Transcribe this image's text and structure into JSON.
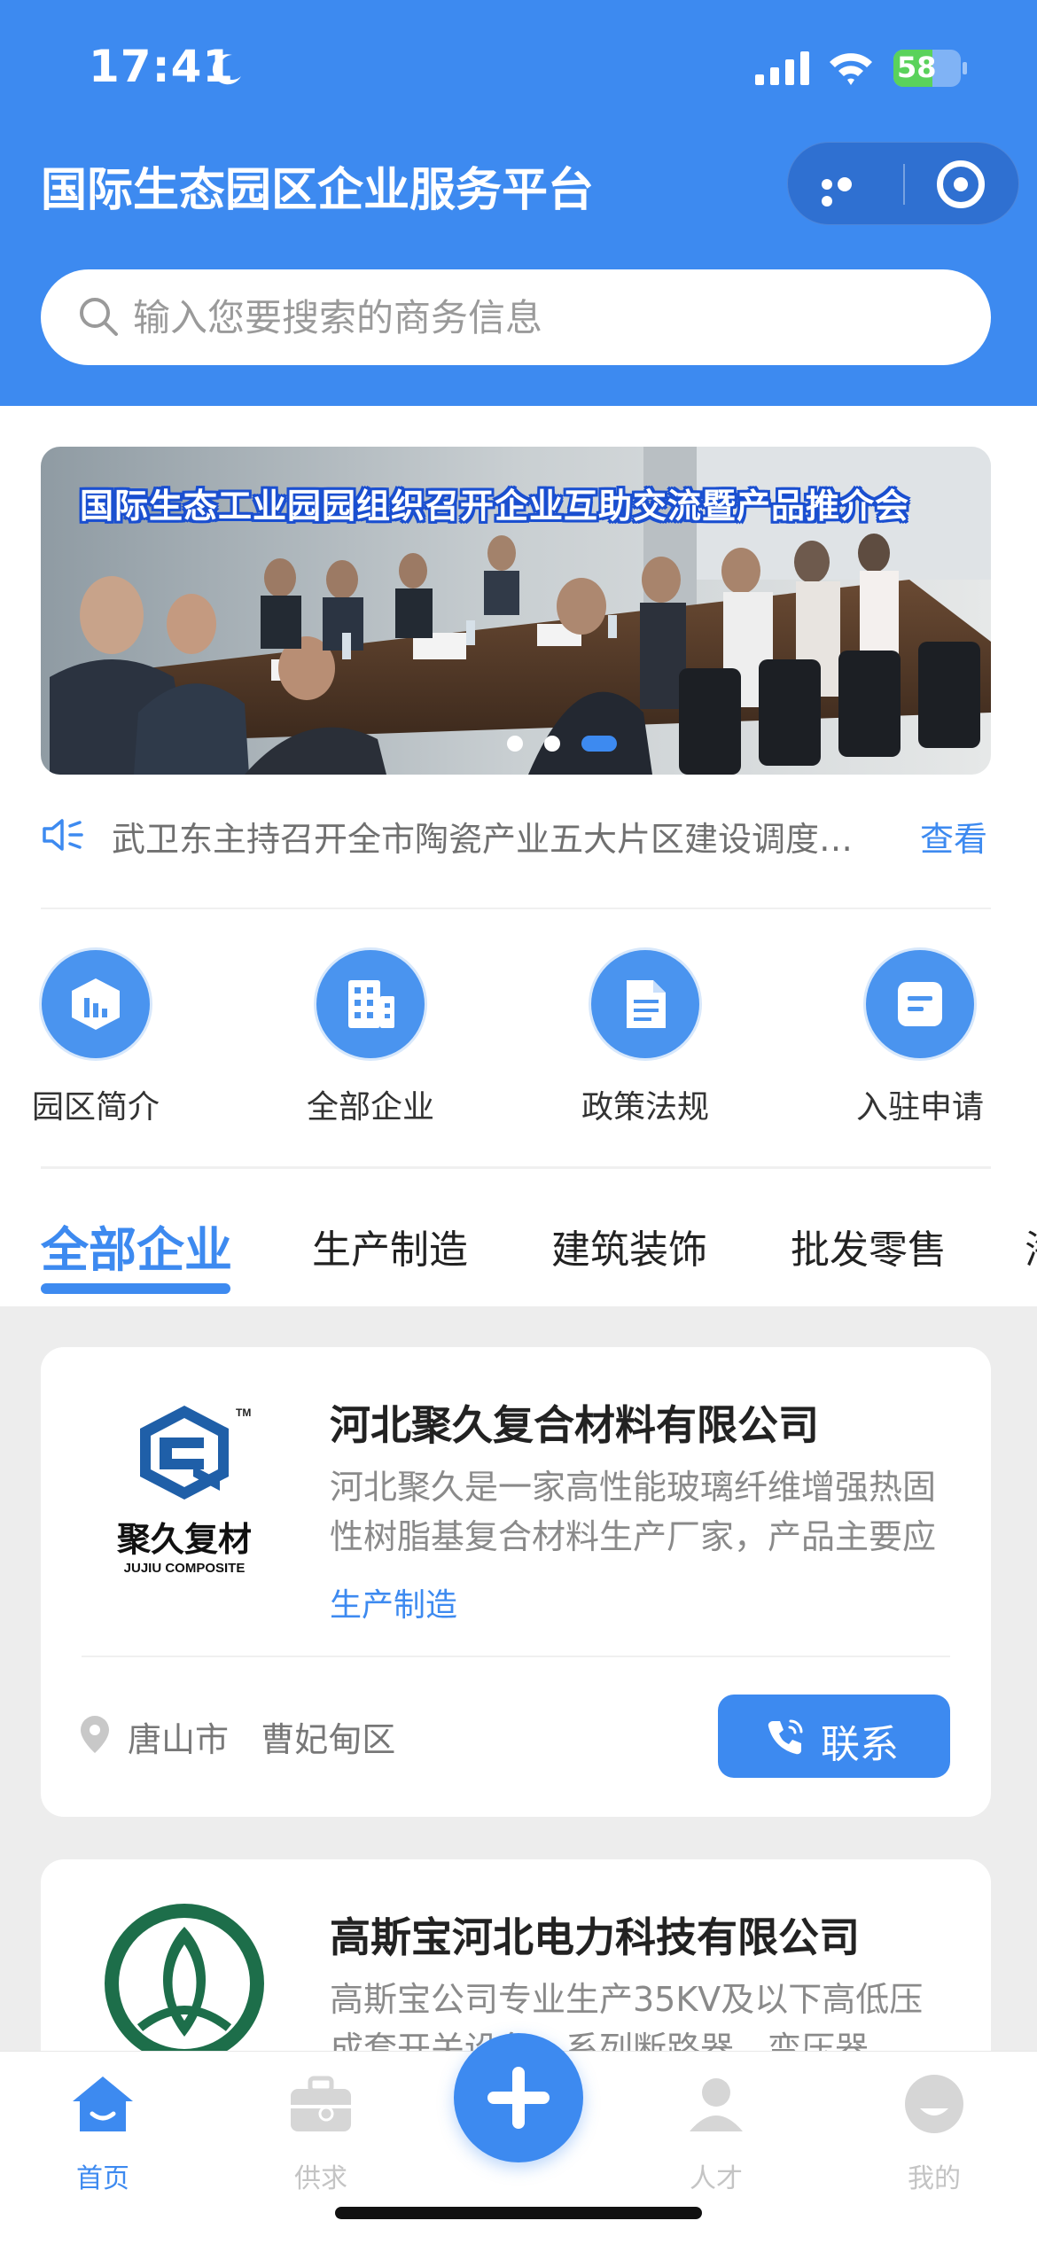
{
  "status_bar": {
    "time": "17:41",
    "battery": "58",
    "battery_level": 0.58
  },
  "header": {
    "title": "国际生态园区企业服务平台",
    "capsule_icons": [
      "more-icon",
      "target-icon"
    ]
  },
  "search": {
    "placeholder": "输入您要搜索的商务信息"
  },
  "banner": {
    "caption": "国际生态工业园园组织召开企业互助交流暨产品推介会",
    "slides": 3,
    "active_slide": 3
  },
  "notice": {
    "text": "武卫东主持召开全市陶瓷产业五大片区建设调度…",
    "more": "查看"
  },
  "quick_links": [
    {
      "label": "园区简介",
      "icon": "chart-icon"
    },
    {
      "label": "全部企业",
      "icon": "building-icon"
    },
    {
      "label": "政策法规",
      "icon": "document-icon"
    },
    {
      "label": "入驻申请",
      "icon": "form-icon"
    }
  ],
  "category_tabs": [
    {
      "label": "全部企业",
      "active": true
    },
    {
      "label": "生产制造",
      "active": false
    },
    {
      "label": "建筑装饰",
      "active": false
    },
    {
      "label": "批发零售",
      "active": false
    },
    {
      "label": "海",
      "active": false
    }
  ],
  "companies": [
    {
      "name": "河北聚久复合材料有限公司",
      "description": "河北聚久是一家高性能玻璃纤维增强热固性树脂基复合材料生产厂家，产品主要应用…",
      "category": "生产制造",
      "city": "唐山市",
      "district": "曹妃甸区",
      "contact_label": "联系",
      "logo": {
        "brand": "聚久复材",
        "sub": "JUJIU COMPOSITE",
        "tm": "TM"
      }
    },
    {
      "name": "高斯宝河北电力科技有限公司",
      "description": "高斯宝公司专业生产35KV及以下高低压成套开关设备、系列断路器、变压器",
      "category": "",
      "city": "",
      "district": ""
    }
  ],
  "tabbar": {
    "items": [
      {
        "label": "首页",
        "active": true
      },
      {
        "label": "供求",
        "active": false
      },
      {
        "label": "人才",
        "active": false
      },
      {
        "label": "我的",
        "active": false
      }
    ]
  },
  "colors": {
    "primary": "#3d8af0",
    "header_bg": "#3d8af0",
    "page_bg": "#ededed"
  }
}
